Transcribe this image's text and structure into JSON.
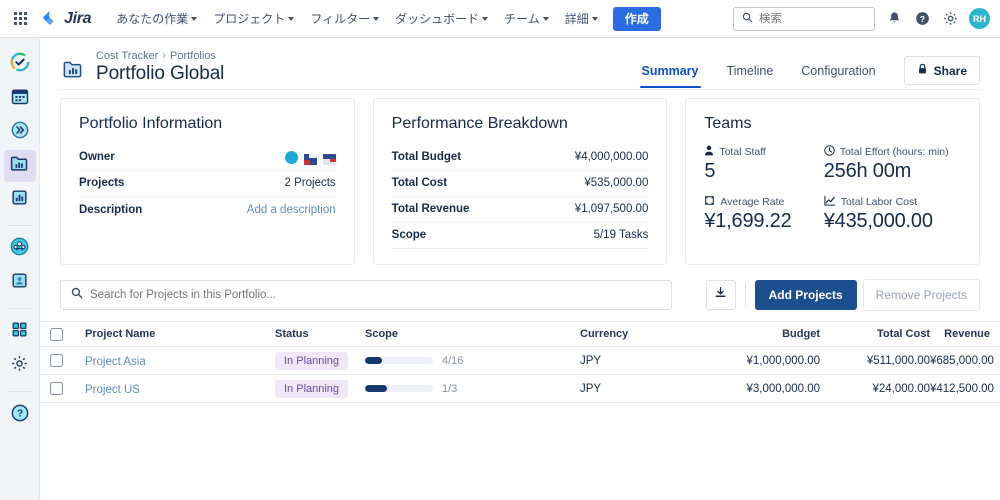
{
  "topnav": {
    "apps_icon": "apps-grid-icon",
    "brand": "Jira",
    "items": [
      {
        "label": "あなたの作業",
        "caret": true
      },
      {
        "label": "プロジェクト",
        "caret": true
      },
      {
        "label": "フィルター",
        "caret": true
      },
      {
        "label": "ダッシュボード",
        "caret": true
      },
      {
        "label": "チーム",
        "caret": true
      },
      {
        "label": "詳細",
        "caret": true
      }
    ],
    "create_label": "作成",
    "search_placeholder": "検索",
    "icons": [
      "notifications-icon",
      "help-icon",
      "settings-icon"
    ],
    "avatar_initials": "RH"
  },
  "rail": {
    "items": [
      {
        "name": "sidebar-item-overview",
        "icon": "check-circle-icon",
        "active": false
      },
      {
        "name": "sidebar-item-calendar",
        "icon": "calendar-icon",
        "active": false
      },
      {
        "name": "sidebar-item-forward",
        "icon": "double-chevron-right-icon",
        "active": false
      },
      {
        "name": "sidebar-item-portfolios",
        "icon": "folder-chart-icon",
        "active": true
      },
      {
        "name": "sidebar-item-reports",
        "icon": "bar-chart-icon",
        "active": false
      },
      {
        "name": "sidebar-item-teams",
        "icon": "people-circle-icon",
        "active": false
      },
      {
        "name": "sidebar-item-staff",
        "icon": "person-box-icon",
        "active": false
      },
      {
        "name": "sidebar-item-apps",
        "icon": "grid-squares-icon",
        "active": false
      },
      {
        "name": "sidebar-item-settings",
        "icon": "gear-icon",
        "active": false
      },
      {
        "name": "sidebar-item-help",
        "icon": "question-circle-icon",
        "active": false
      }
    ]
  },
  "header": {
    "icon": "portfolio-chart-icon",
    "breadcrumb": [
      "Cost Tracker",
      "Portfolios"
    ],
    "breadcrumb_separator": "›",
    "title": "Portfolio Global",
    "tabs": [
      {
        "label": "Summary",
        "active": true
      },
      {
        "label": "Timeline",
        "active": false
      },
      {
        "label": "Configuration",
        "active": false
      }
    ],
    "share_label": "Share",
    "share_icon": "lock-icon"
  },
  "cards": {
    "portfolio_information": {
      "title": "Portfolio Information",
      "rows": [
        {
          "key": "Owner",
          "type": "avatars",
          "value": ""
        },
        {
          "key": "Projects",
          "type": "text",
          "value": "2 Projects"
        },
        {
          "key": "Description",
          "type": "link",
          "value": "Add a description"
        }
      ]
    },
    "performance_breakdown": {
      "title": "Performance Breakdown",
      "rows": [
        {
          "key": "Total Budget",
          "value": "¥4,000,000.00"
        },
        {
          "key": "Total Cost",
          "value": "¥535,000.00"
        },
        {
          "key": "Total Revenue",
          "value": "¥1,097,500.00"
        },
        {
          "key": "Scope",
          "value": "5/19 Tasks"
        }
      ]
    },
    "teams": {
      "title": "Teams",
      "metrics": [
        {
          "label": "Total Staff",
          "icon": "person-icon",
          "value": "5"
        },
        {
          "label": "Total Effort (hours: min)",
          "icon": "clock-icon",
          "value": "256h 00m"
        },
        {
          "label": "Average Rate",
          "icon": "rate-icon",
          "value": "¥1,699.22"
        },
        {
          "label": "Total Labor Cost",
          "icon": "trend-chart-icon",
          "value": "¥435,000.00"
        }
      ]
    }
  },
  "toolbar": {
    "search_placeholder": "Search for Projects in this Portfolio...",
    "search_icon": "search-icon",
    "export_icon": "download-icon",
    "add_projects_label": "Add Projects",
    "remove_projects_label": "Remove Projects"
  },
  "table": {
    "columns": [
      "Project Name",
      "Status",
      "Scope",
      "Currency",
      "Budget",
      "Total Cost",
      "Revenue"
    ],
    "rows": [
      {
        "name": "Project Asia",
        "status": "In Planning",
        "scope_text": "4/16",
        "scope_done": 4,
        "scope_total": 16,
        "currency": "JPY",
        "budget": "¥1,000,000.00",
        "total_cost": "¥511,000.00",
        "revenue": "¥685,000.00"
      },
      {
        "name": "Project US",
        "status": "In Planning",
        "scope_text": "1/3",
        "scope_done": 1,
        "scope_total": 3,
        "currency": "JPY",
        "budget": "¥3,000,000.00",
        "total_cost": "¥24,000.00",
        "revenue": "¥412,500.00"
      }
    ]
  },
  "colors": {
    "brand_blue": "#2b6ce0",
    "accent_dark_blue": "#1d4e8f",
    "tab_active": "#0b50c8",
    "badge_bg": "#f0e7fa",
    "badge_text": "#6b4bab",
    "rail_bg": "#f1f5f8",
    "rail_active_bg": "#dfdcf3",
    "progress_fill": "#15376b",
    "link": "#5e8ac7",
    "avatar_bg": "#2bb6cd"
  }
}
